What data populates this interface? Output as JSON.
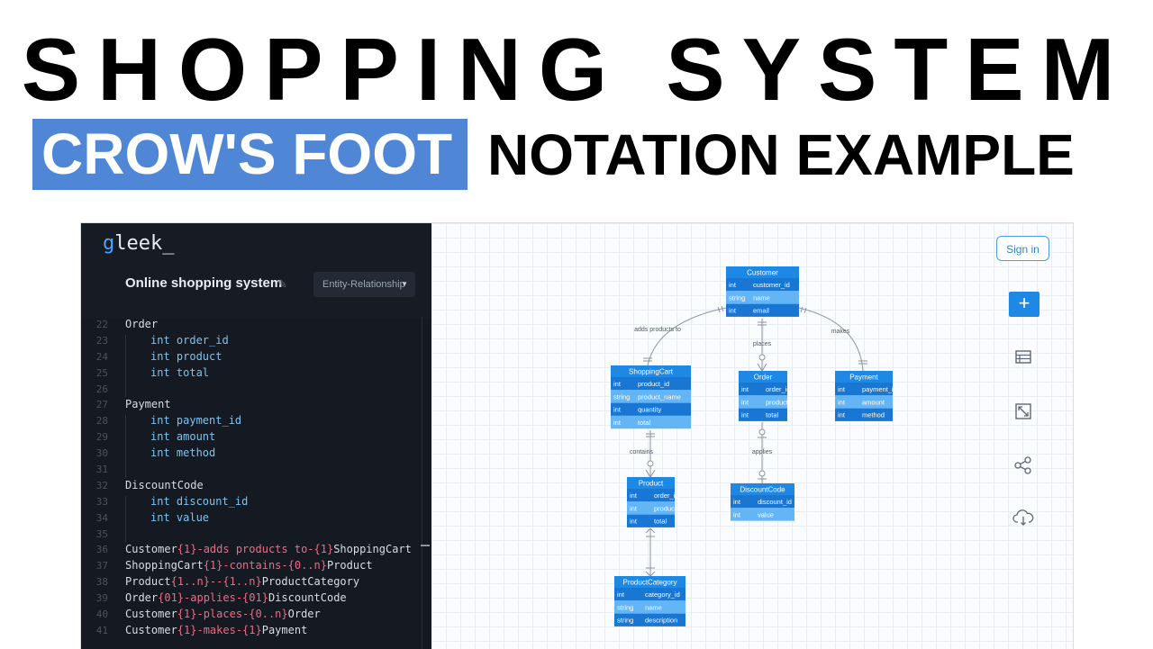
{
  "banner": {
    "title": "SHOPPING SYSTEM",
    "highlight": "CROW'S FOOT",
    "subtitle_rest": "NOTATION EXAMPLE"
  },
  "app": {
    "logo_prefix": "g",
    "logo_rest": "leek_",
    "doc_title": "Online shopping system",
    "diagram_type": "Entity-Relationship",
    "sign_in": "Sign in",
    "add_symbol": "+",
    "icons": [
      "pencil-icon",
      "chevron-down-icon",
      "plus-icon",
      "table-icon",
      "expand-icon",
      "share-icon",
      "cloud-download-icon"
    ]
  },
  "code_lines": [
    {
      "n": "22",
      "indent": false,
      "parts": [
        {
          "t": "Order",
          "c": "plain"
        }
      ]
    },
    {
      "n": "23",
      "indent": true,
      "parts": [
        {
          "t": "int",
          "c": "kw"
        },
        {
          "t": " order_id",
          "c": "kw"
        }
      ]
    },
    {
      "n": "24",
      "indent": true,
      "parts": [
        {
          "t": "int",
          "c": "kw"
        },
        {
          "t": " product",
          "c": "kw"
        }
      ]
    },
    {
      "n": "25",
      "indent": true,
      "parts": [
        {
          "t": "int",
          "c": "kw"
        },
        {
          "t": " total",
          "c": "kw"
        }
      ]
    },
    {
      "n": "26",
      "indent": false,
      "parts": []
    },
    {
      "n": "27",
      "indent": false,
      "parts": [
        {
          "t": "Payment",
          "c": "plain"
        }
      ]
    },
    {
      "n": "28",
      "indent": true,
      "parts": [
        {
          "t": "int",
          "c": "kw"
        },
        {
          "t": " payment_id",
          "c": "kw"
        }
      ]
    },
    {
      "n": "29",
      "indent": true,
      "parts": [
        {
          "t": "int",
          "c": "kw"
        },
        {
          "t": " amount",
          "c": "kw"
        }
      ]
    },
    {
      "n": "30",
      "indent": true,
      "parts": [
        {
          "t": "int",
          "c": "kw"
        },
        {
          "t": " method",
          "c": "kw"
        }
      ]
    },
    {
      "n": "31",
      "indent": false,
      "parts": []
    },
    {
      "n": "32",
      "indent": false,
      "parts": [
        {
          "t": "DiscountCode",
          "c": "plain"
        }
      ]
    },
    {
      "n": "33",
      "indent": true,
      "parts": [
        {
          "t": "int",
          "c": "kw"
        },
        {
          "t": " discount_id",
          "c": "kw"
        }
      ]
    },
    {
      "n": "34",
      "indent": true,
      "parts": [
        {
          "t": "int",
          "c": "kw"
        },
        {
          "t": " value",
          "c": "kw"
        }
      ]
    },
    {
      "n": "35",
      "indent": false,
      "parts": []
    },
    {
      "n": "36",
      "indent": false,
      "parts": [
        {
          "t": "Customer",
          "c": "plain"
        },
        {
          "t": "{1}-adds products to-{1}",
          "c": "rel"
        },
        {
          "t": "ShoppingCart",
          "c": "plain"
        }
      ]
    },
    {
      "n": "37",
      "indent": false,
      "parts": [
        {
          "t": "ShoppingCart",
          "c": "plain"
        },
        {
          "t": "{1}-contains-{0..n}",
          "c": "rel"
        },
        {
          "t": "Product",
          "c": "plain"
        }
      ]
    },
    {
      "n": "38",
      "indent": false,
      "parts": [
        {
          "t": "Product",
          "c": "plain"
        },
        {
          "t": "{1..n}--{1..n}",
          "c": "rel"
        },
        {
          "t": "ProductCategory",
          "c": "plain"
        }
      ]
    },
    {
      "n": "39",
      "indent": false,
      "parts": [
        {
          "t": "Order",
          "c": "plain"
        },
        {
          "t": "{01}-applies-{01}",
          "c": "rel"
        },
        {
          "t": "DiscountCode",
          "c": "plain"
        }
      ]
    },
    {
      "n": "40",
      "indent": false,
      "parts": [
        {
          "t": "Customer",
          "c": "plain"
        },
        {
          "t": "{1}-places-{0..n}",
          "c": "rel"
        },
        {
          "t": "Order",
          "c": "plain"
        }
      ]
    },
    {
      "n": "41",
      "indent": false,
      "parts": [
        {
          "t": "Customer",
          "c": "plain"
        },
        {
          "t": "{1}-makes-{1}",
          "c": "rel"
        },
        {
          "t": "Payment",
          "c": "plain"
        }
      ]
    }
  ],
  "entities": [
    {
      "name": "Customer",
      "rows": [
        [
          "int",
          "customer_id"
        ],
        [
          "string",
          "name"
        ],
        [
          "int",
          "email"
        ]
      ]
    },
    {
      "name": "ShoppingCart",
      "rows": [
        [
          "int",
          "product_id"
        ],
        [
          "string",
          "product_name"
        ],
        [
          "int",
          "quantity"
        ],
        [
          "int",
          "total"
        ]
      ]
    },
    {
      "name": "Order",
      "rows": [
        [
          "int",
          "order_id"
        ],
        [
          "int",
          "product"
        ],
        [
          "int",
          "total"
        ]
      ]
    },
    {
      "name": "Payment",
      "rows": [
        [
          "int",
          "payment_id"
        ],
        [
          "int",
          "amount"
        ],
        [
          "int",
          "method"
        ]
      ]
    },
    {
      "name": "Product",
      "rows": [
        [
          "int",
          "order_id"
        ],
        [
          "int",
          "product"
        ],
        [
          "int",
          "total"
        ]
      ]
    },
    {
      "name": "DiscountCode",
      "rows": [
        [
          "int",
          "discount_id"
        ],
        [
          "int",
          "value"
        ]
      ]
    },
    {
      "name": "ProductCategory",
      "rows": [
        [
          "int",
          "category_id"
        ],
        [
          "string",
          "name"
        ],
        [
          "string",
          "description"
        ]
      ]
    }
  ],
  "relationships": [
    {
      "label": "adds products to"
    },
    {
      "label": "places"
    },
    {
      "label": "makes"
    },
    {
      "label": "contains"
    },
    {
      "label": "applies"
    },
    {
      "label": ""
    }
  ],
  "colors": {
    "highlight": "#4f86d6",
    "sidebar_bg": "#141922",
    "keyword": "#7ec3f0",
    "relation": "#f06a84",
    "entity_header": "#1e88e5",
    "entity_row_dark": "#1976d2",
    "entity_row_light": "#64b5f6"
  }
}
